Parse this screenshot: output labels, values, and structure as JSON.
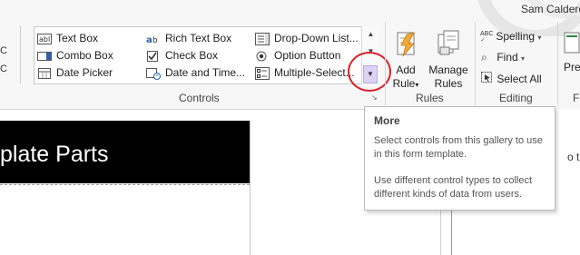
{
  "user": {
    "name": "Sam Calderc"
  },
  "left_stub": {
    "labels": [
      "C",
      "C"
    ]
  },
  "controls_gallery": {
    "columns": [
      [
        {
          "label": "Text Box",
          "icon": "text-box-icon"
        },
        {
          "label": "Combo Box",
          "icon": "combo-box-icon"
        },
        {
          "label": "Date Picker",
          "icon": "date-picker-icon"
        }
      ],
      [
        {
          "label": "Rich Text Box",
          "icon": "rich-text-box-icon"
        },
        {
          "label": "Check Box",
          "icon": "check-box-icon"
        },
        {
          "label": "Date and Time...",
          "icon": "date-time-icon"
        }
      ],
      [
        {
          "label": "Drop-Down List...",
          "icon": "drop-down-list-icon"
        },
        {
          "label": "Option Button",
          "icon": "option-button-icon"
        },
        {
          "label": "Multiple-Select...",
          "icon": "multiple-select-icon"
        }
      ]
    ],
    "group_label": "Controls"
  },
  "rules": {
    "group_label": "Rules",
    "add_rule": {
      "line1": "Add",
      "line2": "Rule"
    },
    "manage_rules": {
      "line1": "Manage",
      "line2": "Rules"
    }
  },
  "editing": {
    "group_label": "Editing",
    "spelling": "Spelling",
    "find": "Find",
    "select_all": "Select All"
  },
  "next_group": {
    "label_fragment": "Pre",
    "group_label_fragment": "F"
  },
  "tooltip": {
    "title": "More",
    "line1": "Select controls from this gallery to use in this form template.",
    "line2": "Use different control types to collect different kinds of data from users."
  },
  "document": {
    "header_text": "plate Parts",
    "right_fragment": "o the"
  },
  "colors": {
    "highlight_button": "#dcd2f4",
    "annotation_circle": "#d9232b",
    "header_bg": "#000000"
  }
}
